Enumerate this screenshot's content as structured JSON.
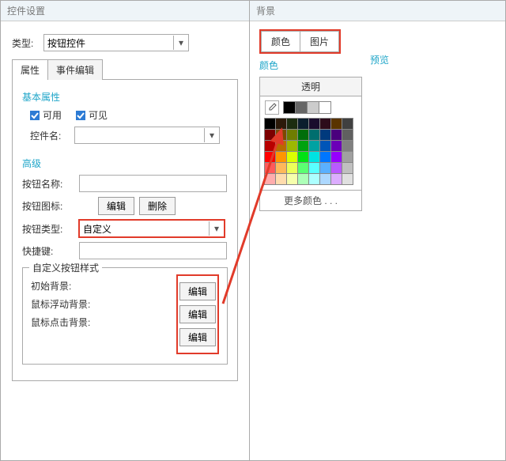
{
  "leftPanel": {
    "title": "控件设置",
    "typeLabel": "类型:",
    "typeValue": "按钮控件",
    "tabs": {
      "attr": "属性",
      "event": "事件编辑"
    },
    "basic": {
      "title": "基本属性",
      "enable": "可用",
      "visible": "可见",
      "controlNameLabel": "控件名:",
      "controlNameValue": ""
    },
    "advanced": {
      "title": "高级",
      "btnNameLabel": "按钮名称:",
      "btnNameValue": "",
      "btnIconLabel": "按钮图标:",
      "editBtn": "编辑",
      "deleteBtn": "删除",
      "btnTypeLabel": "按钮类型:",
      "btnTypeValue": "自定义",
      "shortcutLabel": "快捷键:",
      "shortcutValue": ""
    },
    "customStyle": {
      "legend": "自定义按钮样式",
      "initBg": "初始背景:",
      "hoverBg": "鼠标浮动背景:",
      "clickBg": "鼠标点击背景:",
      "editBtn": "编辑"
    }
  },
  "rightPanel": {
    "title": "背景",
    "tabs": {
      "color": "颜色",
      "image": "图片"
    },
    "colorHead": "颜色",
    "previewHead": "预览",
    "palette": {
      "title": "透明",
      "more": "更多颜色 . . .",
      "picker": [
        "#000000",
        "#666666",
        "#cccccc",
        "#ffffff"
      ],
      "grid": [
        "#000000",
        "#2c1a0a",
        "#1c2d10",
        "#0b1e2d",
        "#1a0c2d",
        "#2d0c1a",
        "#5a3400",
        "#404040",
        "#7d0000",
        "#7d4a00",
        "#6e7d00",
        "#006e0a",
        "#006e6e",
        "#003a7d",
        "#4a007d",
        "#606060",
        "#b80000",
        "#b86b00",
        "#9db800",
        "#00a20f",
        "#00a2a2",
        "#0055b8",
        "#6b00b8",
        "#808080",
        "#ff0000",
        "#ff9600",
        "#dbff00",
        "#00e214",
        "#00e2e2",
        "#0076ff",
        "#9600ff",
        "#a0a0a0",
        "#ff5a5a",
        "#ffb95a",
        "#ecff5a",
        "#5aff72",
        "#5affff",
        "#5ab0ff",
        "#b95aff",
        "#c0c0c0",
        "#ffadad",
        "#ffdcad",
        "#f6ffad",
        "#adffb8",
        "#adffff",
        "#add8ff",
        "#dcadff",
        "#e0e0e0"
      ]
    }
  }
}
